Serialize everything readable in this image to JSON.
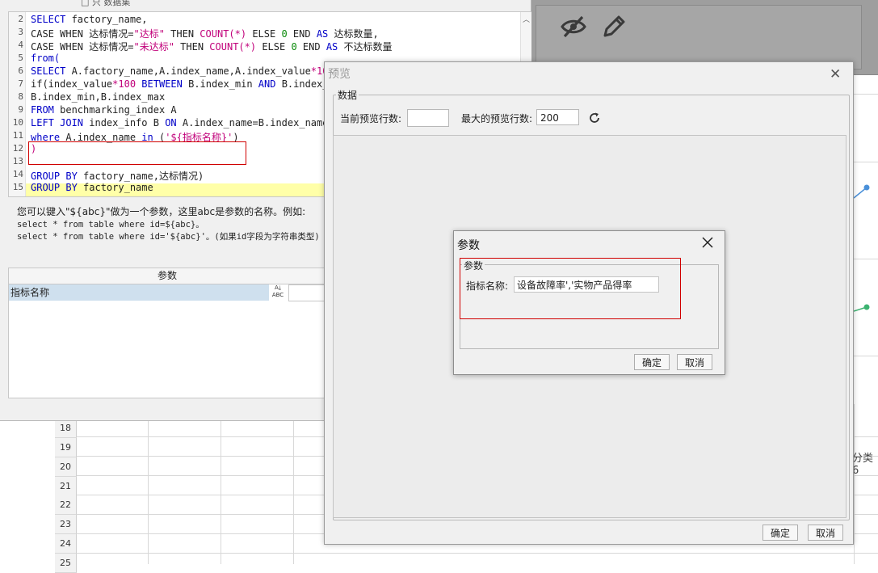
{
  "sql_window": {
    "toolbar_text": "□ 只  数据集",
    "lines": [
      {
        "n": "2",
        "segments": [
          {
            "t": "SELECT",
            "c": "kw"
          },
          {
            "t": " factory_name,",
            "c": ""
          }
        ]
      },
      {
        "n": "3",
        "segments": [
          {
            "t": "CASE WHEN 达标情况=",
            "c": ""
          },
          {
            "t": "\"达标\"",
            "c": "str"
          },
          {
            "t": " THEN ",
            "c": ""
          },
          {
            "t": "COUNT(*)",
            "c": "str"
          },
          {
            "t": " ELSE ",
            "c": ""
          },
          {
            "t": "0",
            "c": "num"
          },
          {
            "t": " END ",
            "c": ""
          },
          {
            "t": "AS",
            "c": "kw"
          },
          {
            "t": " 达标数量,",
            "c": ""
          }
        ]
      },
      {
        "n": "4",
        "segments": [
          {
            "t": "CASE WHEN 达标情况=",
            "c": ""
          },
          {
            "t": "\"未达标\"",
            "c": "str"
          },
          {
            "t": " THEN ",
            "c": ""
          },
          {
            "t": "COUNT(*)",
            "c": "str"
          },
          {
            "t": " ELSE ",
            "c": ""
          },
          {
            "t": "0",
            "c": "num"
          },
          {
            "t": " END ",
            "c": ""
          },
          {
            "t": "AS",
            "c": "kw"
          },
          {
            "t": " 不达标数量",
            "c": ""
          }
        ]
      },
      {
        "n": "5",
        "segments": [
          {
            "t": "from(",
            "c": "kw"
          }
        ]
      },
      {
        "n": "6",
        "segments": [
          {
            "t": "SELECT",
            "c": "kw"
          },
          {
            "t": " A.factory_name,A.index_name,A.index_value",
            "c": ""
          },
          {
            "t": "*100",
            "c": "str"
          }
        ]
      },
      {
        "n": "7",
        "segments": [
          {
            "t": "if(index_value",
            "c": ""
          },
          {
            "t": "*100",
            "c": "str"
          },
          {
            "t": " ",
            "c": ""
          },
          {
            "t": "BETWEEN",
            "c": "kw"
          },
          {
            "t": " B.index_min ",
            "c": ""
          },
          {
            "t": "AND",
            "c": "kw"
          },
          {
            "t": " B.index_m",
            "c": ""
          }
        ]
      },
      {
        "n": "8",
        "segments": [
          {
            "t": "B.index_min,B.index_max",
            "c": ""
          }
        ]
      },
      {
        "n": "9",
        "segments": [
          {
            "t": "FROM",
            "c": "kw"
          },
          {
            "t": " benchmarking_index A",
            "c": ""
          }
        ]
      },
      {
        "n": "10",
        "segments": [
          {
            "t": "LEFT JOIN",
            "c": "kw"
          },
          {
            "t": " index_info B ",
            "c": ""
          },
          {
            "t": "ON",
            "c": "kw"
          },
          {
            "t": " A.index_name=B.index_name",
            "c": ""
          }
        ]
      },
      {
        "n": "11",
        "segments": [
          {
            "t": "where",
            "c": "kw"
          },
          {
            "t": " A.index_name ",
            "c": ""
          },
          {
            "t": "in",
            "c": "kw"
          },
          {
            "t": " (",
            "c": ""
          },
          {
            "t": "'${指标名称}'",
            "c": "str"
          },
          {
            "t": ")",
            "c": ""
          }
        ]
      },
      {
        "n": "12",
        "segments": [
          {
            "t": ")",
            "c": "str"
          }
        ]
      },
      {
        "n": "13",
        "segments": []
      },
      {
        "n": "14",
        "segments": [
          {
            "t": "GROUP BY",
            "c": "kw"
          },
          {
            "t": " factory_name,达标情况)",
            "c": ""
          }
        ]
      },
      {
        "n": "15",
        "segments": [
          {
            "t": "GROUP BY",
            "c": "kw"
          },
          {
            "t": " factory_name",
            "c": ""
          }
        ]
      }
    ],
    "hint_lines": [
      "您可以键入\"${abc}\"做为一个参数，这里abc是参数的名称。例如:",
      "select * from table where id=${abc}。",
      "select * from table where id='${abc}'。(如果id字段为字符串类型)"
    ],
    "param_table": {
      "header": "参数",
      "rows": [
        {
          "name": "指标名称",
          "type_hint": "ABC"
        }
      ]
    }
  },
  "spreadsheet": {
    "row_numbers": [
      "18",
      "19",
      "20",
      "21",
      "22",
      "23",
      "24",
      "25"
    ],
    "side_label": "分类6"
  },
  "preview_dialog": {
    "title": "预览",
    "group_label": "数据",
    "current_rows_label": "当前预览行数:",
    "current_rows_value": "",
    "max_rows_label": "最大的预览行数:",
    "max_rows_value": "200",
    "ok_label": "确定",
    "cancel_label": "取消"
  },
  "param_dialog": {
    "title": "参数",
    "group_label": "参数",
    "field_label": "指标名称:",
    "field_value": "设备故障率','实物产品得率",
    "ok_label": "确定",
    "cancel_label": "取消"
  },
  "colors": {
    "keyword": "#0000c8",
    "string": "#c1007a",
    "number": "#0a8a0a",
    "highlight_line": "#ffffa8",
    "annotation_red": "#d00000"
  },
  "icons": [
    "eye-slash-icon",
    "pencil-icon",
    "refresh-icon",
    "close-icon"
  ]
}
